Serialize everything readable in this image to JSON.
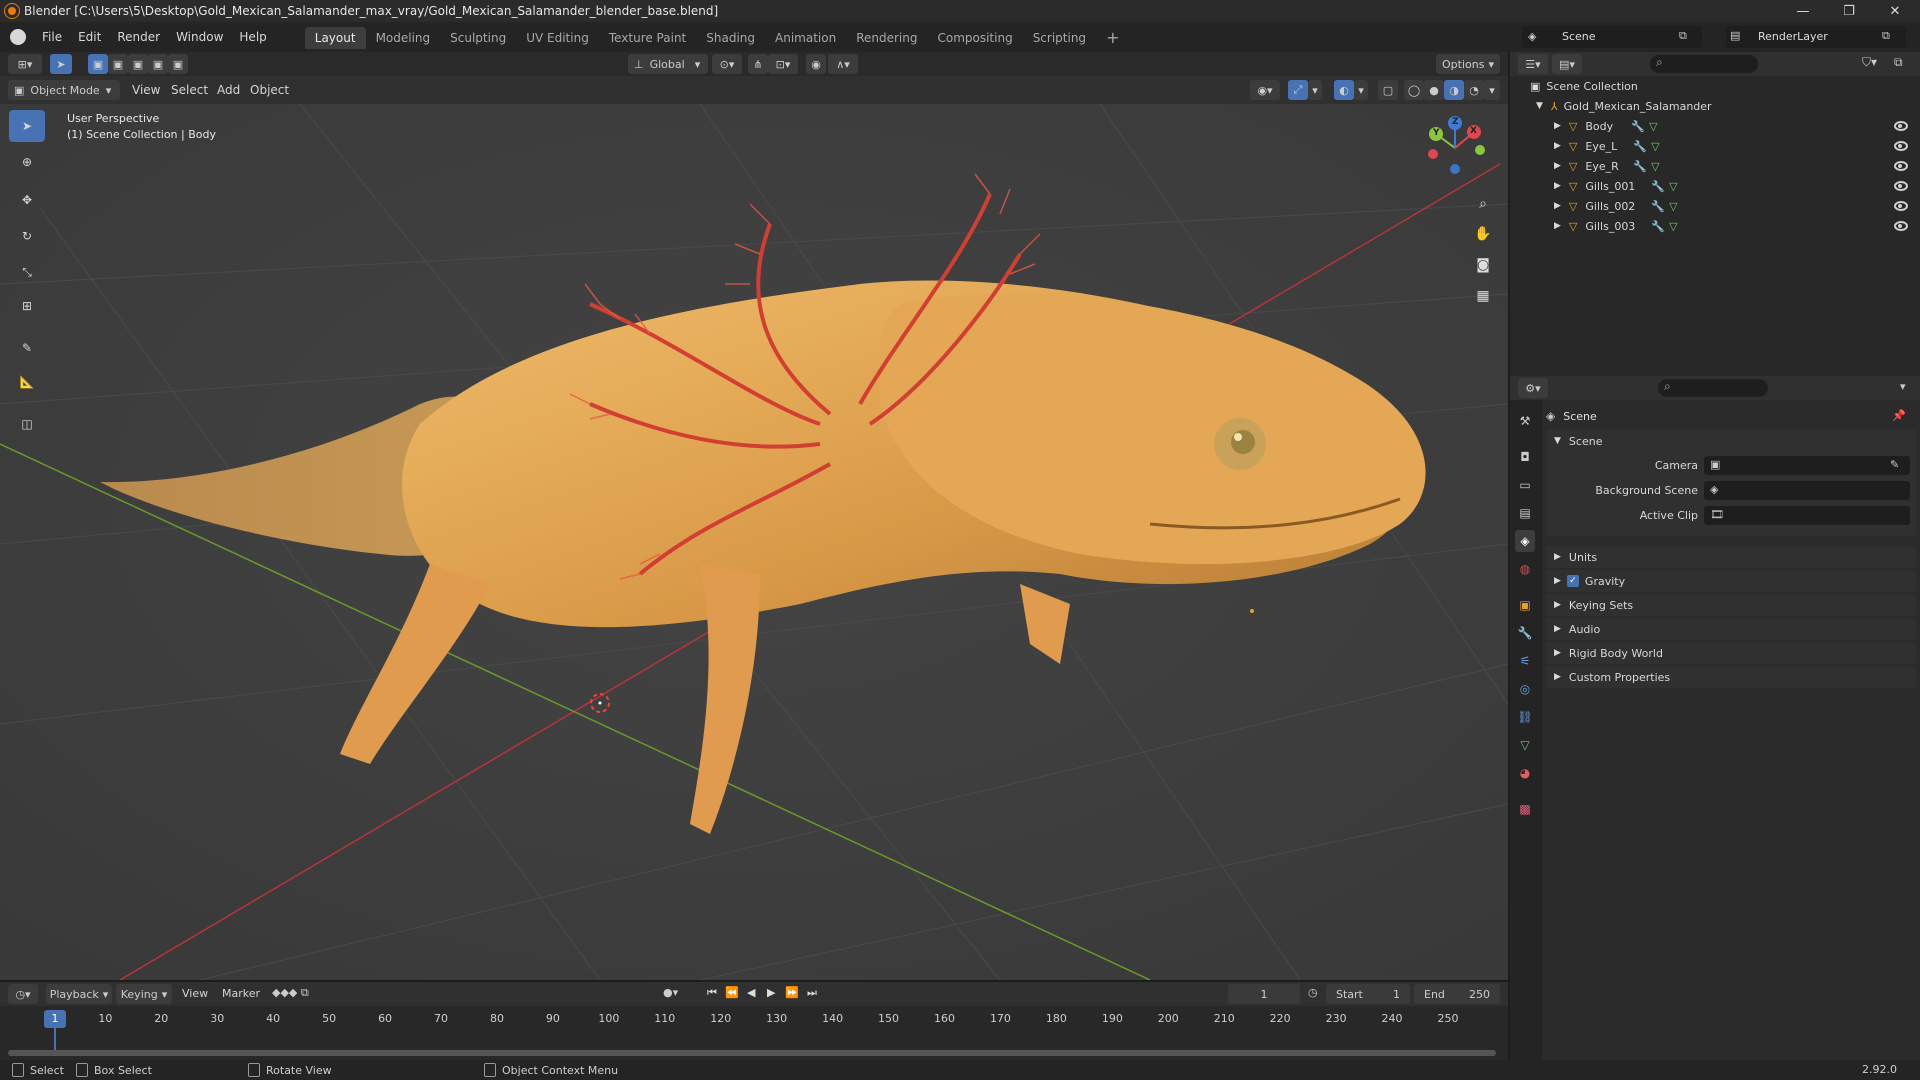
{
  "titlebar": {
    "title": "Blender [C:\\Users\\5\\Desktop\\Gold_Mexican_Salamander_max_vray/Gold_Mexican_Salamander_blender_base.blend]"
  },
  "menu": {
    "items": [
      "File",
      "Edit",
      "Render",
      "Window",
      "Help"
    ]
  },
  "workspaces": {
    "tabs": [
      "Layout",
      "Modeling",
      "Sculpting",
      "UV Editing",
      "Texture Paint",
      "Shading",
      "Animation",
      "Rendering",
      "Compositing",
      "Scripting"
    ],
    "active": "Layout"
  },
  "scene_selector": {
    "scene": "Scene",
    "render_layer": "RenderLayer"
  },
  "toolbar_top": {
    "transform_orientation": "Global",
    "options_label": "Options"
  },
  "viewport_header": {
    "mode": "Object Mode",
    "menus": [
      "View",
      "Select",
      "Add",
      "Object"
    ]
  },
  "viewport": {
    "perspective_label": "User Perspective",
    "collection_label": "(1) Scene Collection | Body"
  },
  "gizmo": {
    "x": "X",
    "y": "Y",
    "z": "Z"
  },
  "outliner": {
    "root": "Scene Collection",
    "collection": "Gold_Mexican_Salamander",
    "objects": [
      "Body",
      "Eye_L",
      "Eye_R",
      "Gills_001",
      "Gills_002",
      "Gills_003"
    ]
  },
  "properties": {
    "context": "Scene",
    "panel": "Scene",
    "fields": [
      {
        "label": "Camera"
      },
      {
        "label": "Background Scene"
      },
      {
        "label": "Active Clip"
      }
    ],
    "sections": [
      "Units",
      "Gravity",
      "Keying Sets",
      "Audio",
      "Rigid Body World",
      "Custom Properties"
    ],
    "gravity_checked": true
  },
  "timeline": {
    "menus": [
      "Playback",
      "Keying",
      "View",
      "Marker"
    ],
    "current_frame": "1",
    "start_label": "Start",
    "start": "1",
    "end_label": "End",
    "end": "250",
    "ticks": [
      "1",
      "10",
      "20",
      "30",
      "40",
      "50",
      "60",
      "70",
      "80",
      "90",
      "100",
      "110",
      "120",
      "130",
      "140",
      "150",
      "160",
      "170",
      "180",
      "190",
      "200",
      "210",
      "220",
      "230",
      "240",
      "250"
    ]
  },
  "statusbar": {
    "select": "Select",
    "box_select": "Box Select",
    "rotate_view": "Rotate View",
    "context_menu": "Object Context Menu",
    "version": "2.92.0"
  },
  "colors": {
    "accent": "#4772b3",
    "x_axis": "#e2454f",
    "y_axis": "#8cc63f",
    "z_axis": "#3d7bd6",
    "salamander": "#e5a857",
    "gills": "#e0493c"
  }
}
